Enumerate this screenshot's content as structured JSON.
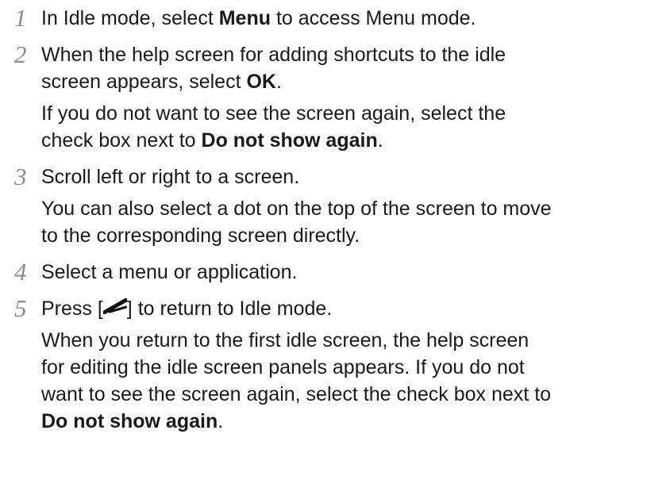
{
  "steps": [
    {
      "num": "1",
      "lines": [
        {
          "parts": [
            {
              "t": "In Idle mode, select "
            },
            {
              "t": "Menu",
              "b": true
            },
            {
              "t": " to access Menu mode."
            }
          ]
        }
      ]
    },
    {
      "num": "2",
      "lines": [
        {
          "parts": [
            {
              "t": "When the help screen for adding shortcuts to the idle"
            }
          ]
        },
        {
          "parts": [
            {
              "t": "screen appears, select "
            },
            {
              "t": "OK",
              "b": true
            },
            {
              "t": "."
            }
          ]
        },
        {
          "note": true,
          "parts": [
            {
              "t": "If you do not want to see the screen again, select the"
            }
          ]
        },
        {
          "parts": [
            {
              "t": "check box next to "
            },
            {
              "t": "Do not show again",
              "b": true
            },
            {
              "t": "."
            }
          ]
        }
      ]
    },
    {
      "num": "3",
      "lines": [
        {
          "parts": [
            {
              "t": "Scroll left or right to a screen."
            }
          ]
        },
        {
          "note": true,
          "parts": [
            {
              "t": "You can also select a dot on the top of the screen to move"
            }
          ]
        },
        {
          "parts": [
            {
              "t": "to the corresponding screen directly."
            }
          ]
        }
      ]
    },
    {
      "num": "4",
      "lines": [
        {
          "parts": [
            {
              "t": "Select a menu or application."
            }
          ]
        }
      ]
    },
    {
      "num": "5",
      "lines": [
        {
          "parts": [
            {
              "t": "Press ["
            },
            {
              "icon": "back-key-icon"
            },
            {
              "t": "] to return to Idle mode."
            }
          ]
        },
        {
          "note": true,
          "parts": [
            {
              "t": "When you return to the first idle screen, the help screen"
            }
          ]
        },
        {
          "parts": [
            {
              "t": "for editing the idle screen panels appears. If you do not"
            }
          ]
        },
        {
          "parts": [
            {
              "t": "want to see the screen again, select the check box next to"
            }
          ]
        },
        {
          "parts": [
            {
              "t": "Do not show again",
              "b": true
            },
            {
              "t": "."
            }
          ]
        }
      ]
    }
  ]
}
